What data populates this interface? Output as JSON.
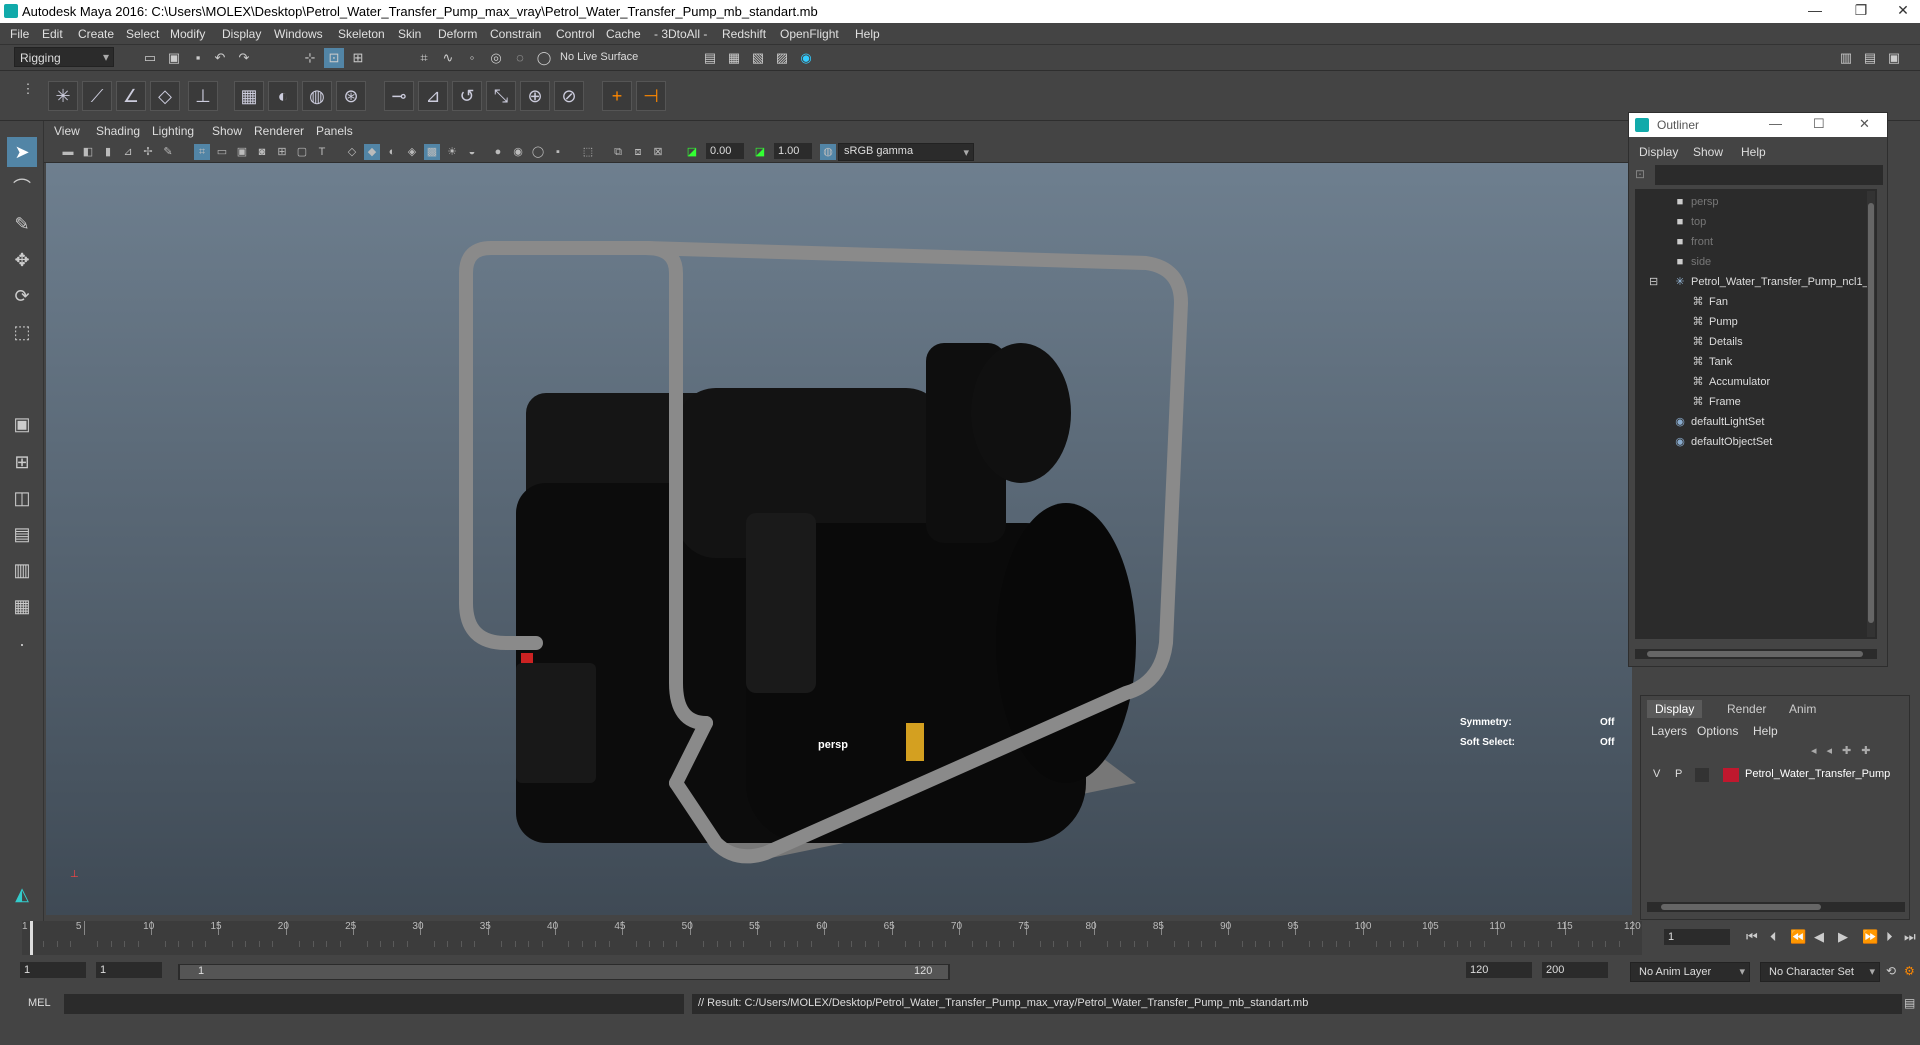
{
  "window": {
    "title": "Autodesk Maya 2016: C:\\Users\\MOLEX\\Desktop\\Petrol_Water_Transfer_Pump_max_vray\\Petrol_Water_Transfer_Pump_mb_standart.mb",
    "minimize": "—",
    "restore": "❐",
    "close": "✕"
  },
  "menubar": [
    "File",
    "Edit",
    "Create",
    "Select",
    "Modify",
    "Display",
    "Windows",
    "Skeleton",
    "Skin",
    "Deform",
    "Constrain",
    "Control",
    "Cache",
    "- 3DtoAll -",
    "Redshift",
    "OpenFlight",
    "Help"
  ],
  "statusline": {
    "menuset": "Rigging",
    "live_surface": "No Live Surface"
  },
  "panel_menu": [
    "View",
    "Shading",
    "Lighting",
    "Show",
    "Renderer",
    "Panels"
  ],
  "panel_toolbar": {
    "field1": "0.00",
    "field2": "1.00",
    "colorspace": "sRGB gamma"
  },
  "viewport": {
    "camera": "persp",
    "symmetry_label": "Symmetry:",
    "symmetry_value": "Off",
    "soft_select_label": "Soft Select:",
    "soft_select_value": "Off"
  },
  "outliner": {
    "title": "Outliner",
    "menu": [
      "Display",
      "Show",
      "Help"
    ],
    "items": [
      {
        "label": "persp",
        "icon": "camera-icon",
        "dim": true,
        "indent": 1
      },
      {
        "label": "top",
        "icon": "camera-icon",
        "dim": true,
        "indent": 1
      },
      {
        "label": "front",
        "icon": "camera-icon",
        "dim": true,
        "indent": 1
      },
      {
        "label": "side",
        "icon": "camera-icon",
        "dim": true,
        "indent": 1
      },
      {
        "label": "Petrol_Water_Transfer_Pump_ncl1_",
        "icon": "group-icon",
        "dim": false,
        "indent": 0
      },
      {
        "label": "Fan",
        "icon": "mesh-icon",
        "dim": false,
        "indent": 2
      },
      {
        "label": "Pump",
        "icon": "mesh-icon",
        "dim": false,
        "indent": 2
      },
      {
        "label": "Details",
        "icon": "mesh-icon",
        "dim": false,
        "indent": 2
      },
      {
        "label": "Tank",
        "icon": "mesh-icon",
        "dim": false,
        "indent": 2
      },
      {
        "label": "Accumulator",
        "icon": "mesh-icon",
        "dim": false,
        "indent": 2
      },
      {
        "label": "Frame",
        "icon": "mesh-icon",
        "dim": false,
        "indent": 2
      },
      {
        "label": "defaultLightSet",
        "icon": "set-icon",
        "dim": false,
        "indent": 1
      },
      {
        "label": "defaultObjectSet",
        "icon": "set-icon",
        "dim": false,
        "indent": 1
      }
    ]
  },
  "layers": {
    "tabs": [
      "Display",
      "Render",
      "Anim"
    ],
    "menu": [
      "Layers",
      "Options",
      "Help"
    ],
    "rows": [
      {
        "v": "V",
        "p": "P",
        "name": "Petrol_Water_Transfer_Pump",
        "color": "#c0182e"
      }
    ]
  },
  "timeline": {
    "ticks": [
      "1",
      "5",
      "10",
      "15",
      "20",
      "25",
      "30",
      "35",
      "40",
      "45",
      "50",
      "55",
      "60",
      "65",
      "70",
      "75",
      "80",
      "85",
      "90",
      "95",
      "100",
      "105",
      "110",
      "115",
      "120"
    ],
    "current_frame": "1"
  },
  "range": {
    "start": "1",
    "playback_start": "1",
    "slider_start": "1",
    "slider_end": "120",
    "playback_end": "120",
    "end": "200",
    "anim_layer": "No Anim Layer",
    "character_set": "No Character Set"
  },
  "cmdline": {
    "mode": "MEL",
    "result": "// Result: C:/Users/MOLEX/Desktop/Petrol_Water_Transfer_Pump_max_vray/Petrol_Water_Transfer_Pump_mb_standart.mb"
  }
}
